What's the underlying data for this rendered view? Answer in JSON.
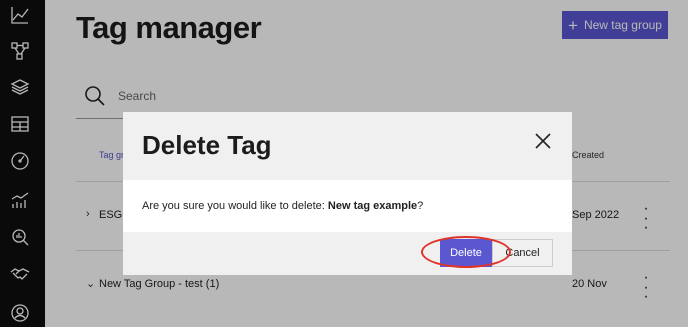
{
  "sidebar": {
    "icons": [
      "analytics-line-icon",
      "network-nodes-icon",
      "layers-icon",
      "table-icon",
      "gauge-icon",
      "bar-trend-icon",
      "search-doc-icon",
      "handshake-icon",
      "user-circle-icon"
    ]
  },
  "page": {
    "title": "Tag manager",
    "new_button_label": "New tag group",
    "search_placeholder": "Search"
  },
  "table": {
    "headers": {
      "group": "Tag gro",
      "created": "Created"
    },
    "rows": [
      {
        "chevron": "›",
        "name": "ESG (",
        "date": "Sep 2022"
      },
      {
        "chevron": "⌄",
        "name": "New Tag Group - test (1)",
        "date": "20 Nov"
      }
    ]
  },
  "modal": {
    "title": "Delete Tag",
    "message_prefix": "Are you sure you would like to delete: ",
    "tag_name": "New tag example",
    "message_suffix": "?",
    "delete_label": "Delete",
    "cancel_label": "Cancel"
  },
  "colors": {
    "accent": "#5b57d1",
    "highlight": "#e0342a",
    "sidebar": "#0e0e0e"
  }
}
